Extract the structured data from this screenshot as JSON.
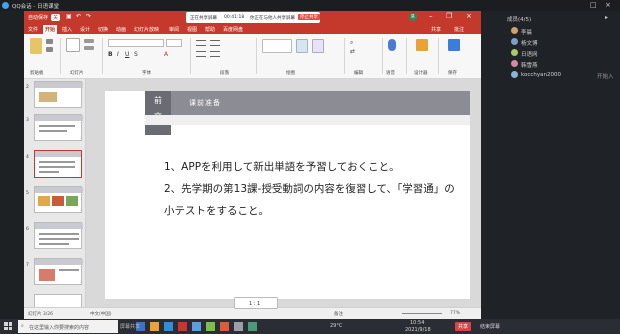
{
  "qq": {
    "title": "QQ会话 - 日语课堂",
    "screen_share_prefix": "正在共享屏幕",
    "timer": "00:41:18",
    "notice": "你正在与他人共享屏幕",
    "end_btn": "停止共享"
  },
  "ppt": {
    "autosave": "自动保存",
    "autosave_state": "关",
    "user_initial": "R",
    "tabs": [
      "文件",
      "开始",
      "插入",
      "设计",
      "切换",
      "动画",
      "幻灯片放映",
      "审阅",
      "视图",
      "帮助",
      "百度网盘"
    ],
    "share_btn": "共享",
    "comment_btn": "批注",
    "groups": [
      "剪贴板",
      "幻灯片",
      "字体",
      "段落",
      "绘图",
      "编辑",
      "语音",
      "设计器",
      "保存"
    ],
    "slide": {
      "tag_line1": "前",
      "tag_line2": "文",
      "header": "课前准备",
      "line1": "1、APPを利用して新出単語を予習しておくこと。",
      "line2": "2、先学期の第13課-授受動詞の内容を復習して、「学習通」の",
      "line3": "小テストをすること。"
    },
    "thumb_numbers": [
      "2",
      "3",
      "4",
      "5",
      "6",
      "7"
    ],
    "status_left": "幻灯片 3/26",
    "status_lang": "中文(中国)",
    "status_notes": "备注",
    "zoom": "77%"
  },
  "panel": {
    "title": "成员(4/5)",
    "members": [
      {
        "name": "李晨",
        "note": ""
      },
      {
        "name": "杨文博",
        "note": ""
      },
      {
        "name": "日语网",
        "note": ""
      },
      {
        "name": "韩雪燕",
        "note": ""
      },
      {
        "name": "kocchyan2000",
        "note": "开始入"
      }
    ]
  },
  "taskbar": {
    "search_placeholder": "在这里输入你要搜索的内容",
    "share_toggle": "1 : 1",
    "weather": "29°C",
    "time": "10:54",
    "date": "2021/9/18",
    "share_label": "共享",
    "end_label": "结束屏幕",
    "screen_label": "屏幕共享"
  },
  "colors": {
    "ppt_red": "#c4392b",
    "slide_band": "#8c8c94",
    "slide_tag": "#6b6b74",
    "accent_blue": "#2f7bd6"
  }
}
